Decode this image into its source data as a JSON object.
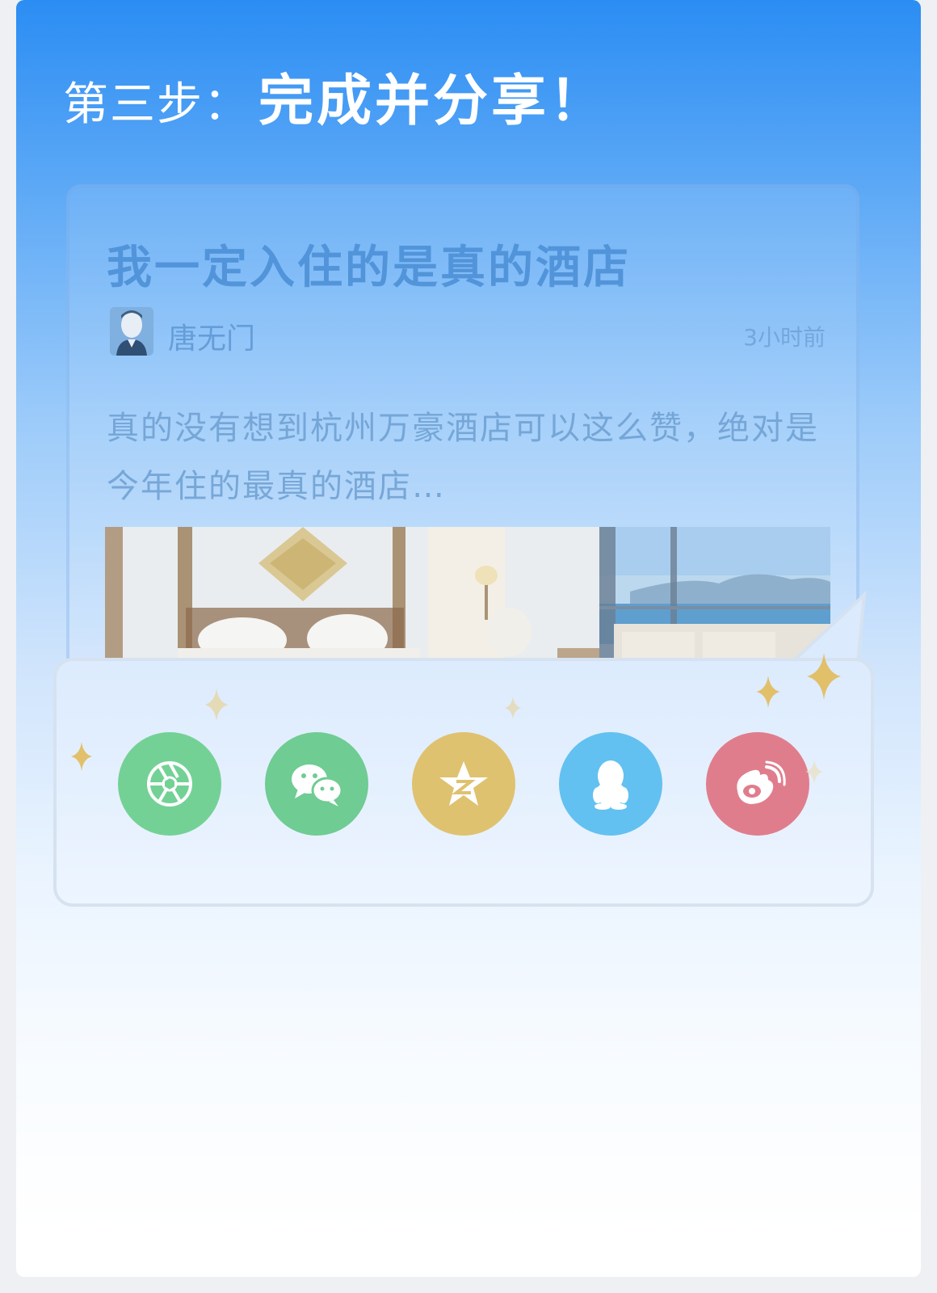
{
  "step": {
    "prefix": "第三步：",
    "title": "完成并分享！"
  },
  "post": {
    "title": "我一定入住的是真的酒店",
    "author": "唐无门",
    "time": "3小时前",
    "excerpt": "真的没有想到杭州万豪酒店可以这么赞，绝对是今年住的最真的酒店…"
  },
  "share": {
    "buttons": [
      {
        "icon": "moments-aperture-icon",
        "color": "#74d196"
      },
      {
        "icon": "wechat-icon",
        "color": "#6fcc93"
      },
      {
        "icon": "qzone-star-icon",
        "color": "#dfc26f"
      },
      {
        "icon": "qq-penguin-icon",
        "color": "#62c1f0"
      },
      {
        "icon": "weibo-icon",
        "color": "#e07d8d"
      }
    ]
  },
  "colors": {
    "header_blue": "#2b8df3",
    "sparkle_gold": "#e2c06a"
  }
}
